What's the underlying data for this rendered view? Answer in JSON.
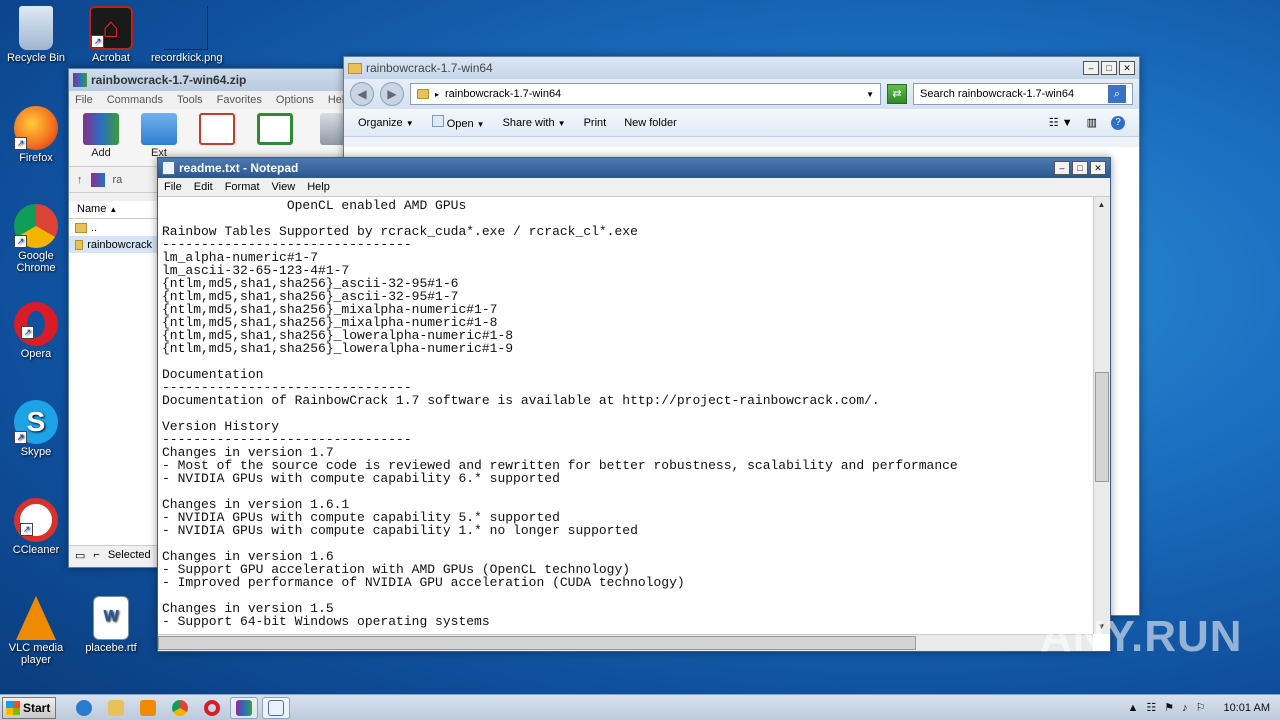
{
  "desktop": {
    "icons": [
      {
        "label": "Recycle Bin",
        "icon": "recycle-bin-icon"
      },
      {
        "label": "Acrobat",
        "icon": "acrobat-icon"
      },
      {
        "label": "recordkick.png",
        "icon": "image-file-icon"
      },
      {
        "label": "Firefox",
        "icon": "firefox-icon"
      },
      {
        "label": "Google Chrome",
        "icon": "chrome-icon"
      },
      {
        "label": "Opera",
        "icon": "opera-icon"
      },
      {
        "label": "Skype",
        "icon": "skype-icon"
      },
      {
        "label": "CCleaner",
        "icon": "ccleaner-icon"
      },
      {
        "label": "VLC media player",
        "icon": "vlc-icon"
      },
      {
        "label": "placebe.rtf",
        "icon": "word-document-icon"
      }
    ]
  },
  "winrar": {
    "title": "rainbowcrack-1.7-win64.zip",
    "menu": [
      "File",
      "Commands",
      "Tools",
      "Favorites",
      "Options",
      "Help"
    ],
    "tools": [
      {
        "label": "Add"
      },
      {
        "label": "Ext"
      },
      {
        "label": ""
      },
      {
        "label": ""
      },
      {
        "label": ""
      }
    ],
    "path": "ra",
    "list_header": "Name",
    "rows": [
      "..",
      "rainbowcrack"
    ],
    "status": "Selected"
  },
  "explorer": {
    "title": "rainbowcrack-1.7-win64",
    "address": "rainbowcrack-1.7-win64",
    "search_placeholder": "Search rainbowcrack-1.7-win64",
    "commands": [
      "Organize",
      "Open",
      "Share with",
      "Print",
      "New folder"
    ]
  },
  "notepad": {
    "title": "readme.txt - Notepad",
    "menu": [
      "File",
      "Edit",
      "Format",
      "View",
      "Help"
    ],
    "lines": [
      "                OpenCL enabled AMD GPUs",
      "",
      "Rainbow Tables Supported by rcrack_cuda*.exe / rcrack_cl*.exe",
      "--------------------------------",
      "lm_alpha-numeric#1-7",
      "lm_ascii-32-65-123-4#1-7",
      "{ntlm,md5,sha1,sha256}_ascii-32-95#1-6",
      "{ntlm,md5,sha1,sha256}_ascii-32-95#1-7",
      "{ntlm,md5,sha1,sha256}_mixalpha-numeric#1-7",
      "{ntlm,md5,sha1,sha256}_mixalpha-numeric#1-8",
      "{ntlm,md5,sha1,sha256}_loweralpha-numeric#1-8",
      "{ntlm,md5,sha1,sha256}_loweralpha-numeric#1-9",
      "",
      "Documentation",
      "--------------------------------",
      "Documentation of RainbowCrack 1.7 software is available at http://project-rainbowcrack.com/.",
      "",
      "Version History",
      "--------------------------------",
      "Changes in version 1.7",
      "- Most of the source code is reviewed and rewritten for better robustness, scalability and performance",
      "- NVIDIA GPUs with compute capability 6.* supported",
      "",
      "Changes in version 1.6.1",
      "- NVIDIA GPUs with compute capability 5.* supported",
      "- NVIDIA GPUs with compute capability 1.* no longer supported",
      "",
      "Changes in version 1.6",
      "- Support GPU acceleration with AMD GPUs (OpenCL technology)",
      "- Improved performance of NVIDIA GPU acceleration (CUDA technology)",
      "",
      "Changes in version 1.5",
      "- Support 64-bit Windows operating systems"
    ]
  },
  "taskbar": {
    "start_label": "Start",
    "apps": [
      "ie-icon",
      "explorer-icon",
      "media-player-icon",
      "chrome-icon",
      "opera-icon",
      "winrar-icon",
      "notepad-icon"
    ],
    "clock": "10:01 AM"
  },
  "watermark": "ANY.RUN"
}
